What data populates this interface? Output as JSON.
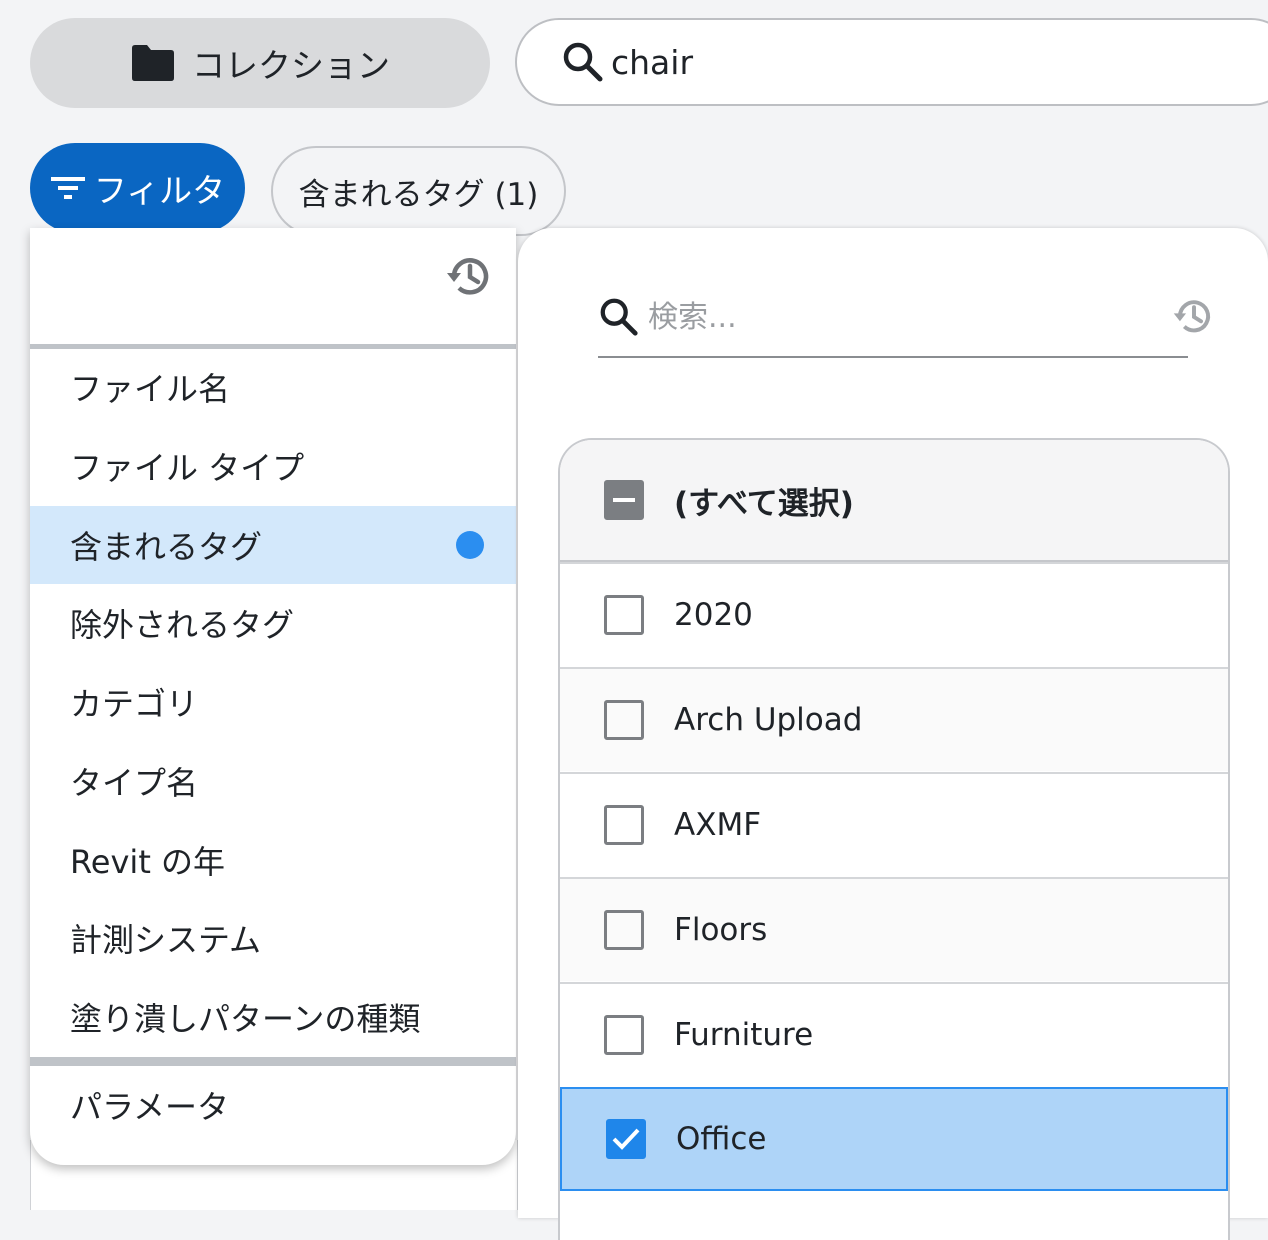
{
  "toolbar": {
    "collection_label": "コレクション",
    "search_value": "chair"
  },
  "filter_bar": {
    "filter_label": "フィルタ",
    "active_chip_label": "含まれるタグ (1)"
  },
  "filter_menu": {
    "items": [
      {
        "label": "ファイル名"
      },
      {
        "label": "ファイル タイプ"
      },
      {
        "label": "含まれるタグ",
        "active": true,
        "has_indicator": true
      },
      {
        "label": "除外されるタグ"
      },
      {
        "label": "カテゴリ"
      },
      {
        "label": "タイプ名"
      },
      {
        "label": "Revit の年"
      },
      {
        "label": "計測システム"
      },
      {
        "label": "塗り潰しパターンの種類"
      }
    ],
    "extra_items": [
      {
        "label": "パラメータ"
      }
    ]
  },
  "tag_panel": {
    "search_placeholder": "検索...",
    "select_all_label": "(すべて選択)",
    "select_all_state": "indeterminate",
    "options": [
      {
        "label": "2020",
        "checked": false
      },
      {
        "label": "Arch Upload",
        "checked": false
      },
      {
        "label": "AXMF",
        "checked": false
      },
      {
        "label": "Floors",
        "checked": false
      },
      {
        "label": "Furniture",
        "checked": false
      },
      {
        "label": "Office",
        "checked": true
      }
    ]
  },
  "colors": {
    "primary": "#0a66c2",
    "active_row": "#d3e8fb",
    "selected_row": "#aed4f8",
    "indicator": "#2b8ef0"
  }
}
